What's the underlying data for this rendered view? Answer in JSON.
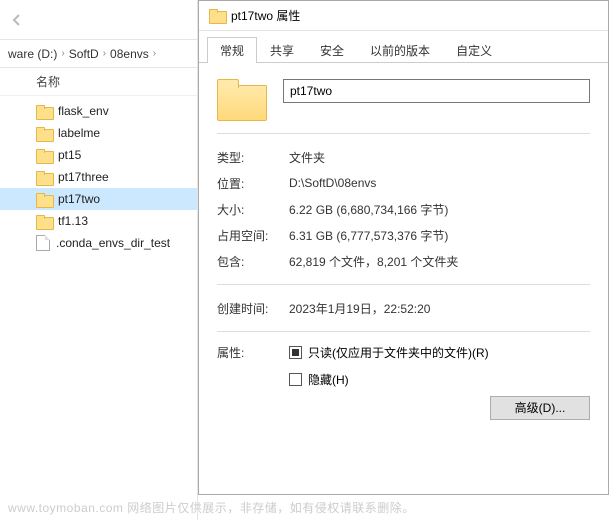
{
  "explorer": {
    "breadcrumb": [
      "ware (D:)",
      "SoftD",
      "08envs"
    ],
    "column_header": "名称",
    "items": [
      {
        "type": "folder",
        "label": "flask_env"
      },
      {
        "type": "folder",
        "label": "labelme"
      },
      {
        "type": "folder",
        "label": "pt15"
      },
      {
        "type": "folder",
        "label": "pt17three"
      },
      {
        "type": "folder",
        "label": "pt17two",
        "selected": true
      },
      {
        "type": "folder",
        "label": "tf1.13"
      },
      {
        "type": "file",
        "label": ".conda_envs_dir_test"
      }
    ]
  },
  "props": {
    "title": "pt17two 属性",
    "tabs": [
      {
        "label": "常规",
        "active": true
      },
      {
        "label": "共享"
      },
      {
        "label": "安全"
      },
      {
        "label": "以前的版本"
      },
      {
        "label": "自定义"
      }
    ],
    "name_value": "pt17two",
    "rows": {
      "type_label": "类型:",
      "type_value": "文件夹",
      "location_label": "位置:",
      "location_value": "D:\\SoftD\\08envs",
      "size_label": "大小:",
      "size_value": "6.22 GB (6,680,734,166 字节)",
      "disk_label": "占用空间:",
      "disk_value": "6.31 GB (6,777,573,376 字节)",
      "contains_label": "包含:",
      "contains_value": "62,819 个文件，8,201 个文件夹",
      "created_label": "创建时间:",
      "created_value": "2023年1月19日，22:52:20",
      "attr_label": "属性:",
      "readonly_label": "只读(仅应用于文件夹中的文件)(R)",
      "hidden_label": "隐藏(H)",
      "advanced_label": "高级(D)..."
    }
  },
  "watermark": "www.toymoban.com    网络图片仅供展示，非存储，如有侵权请联系删除。"
}
